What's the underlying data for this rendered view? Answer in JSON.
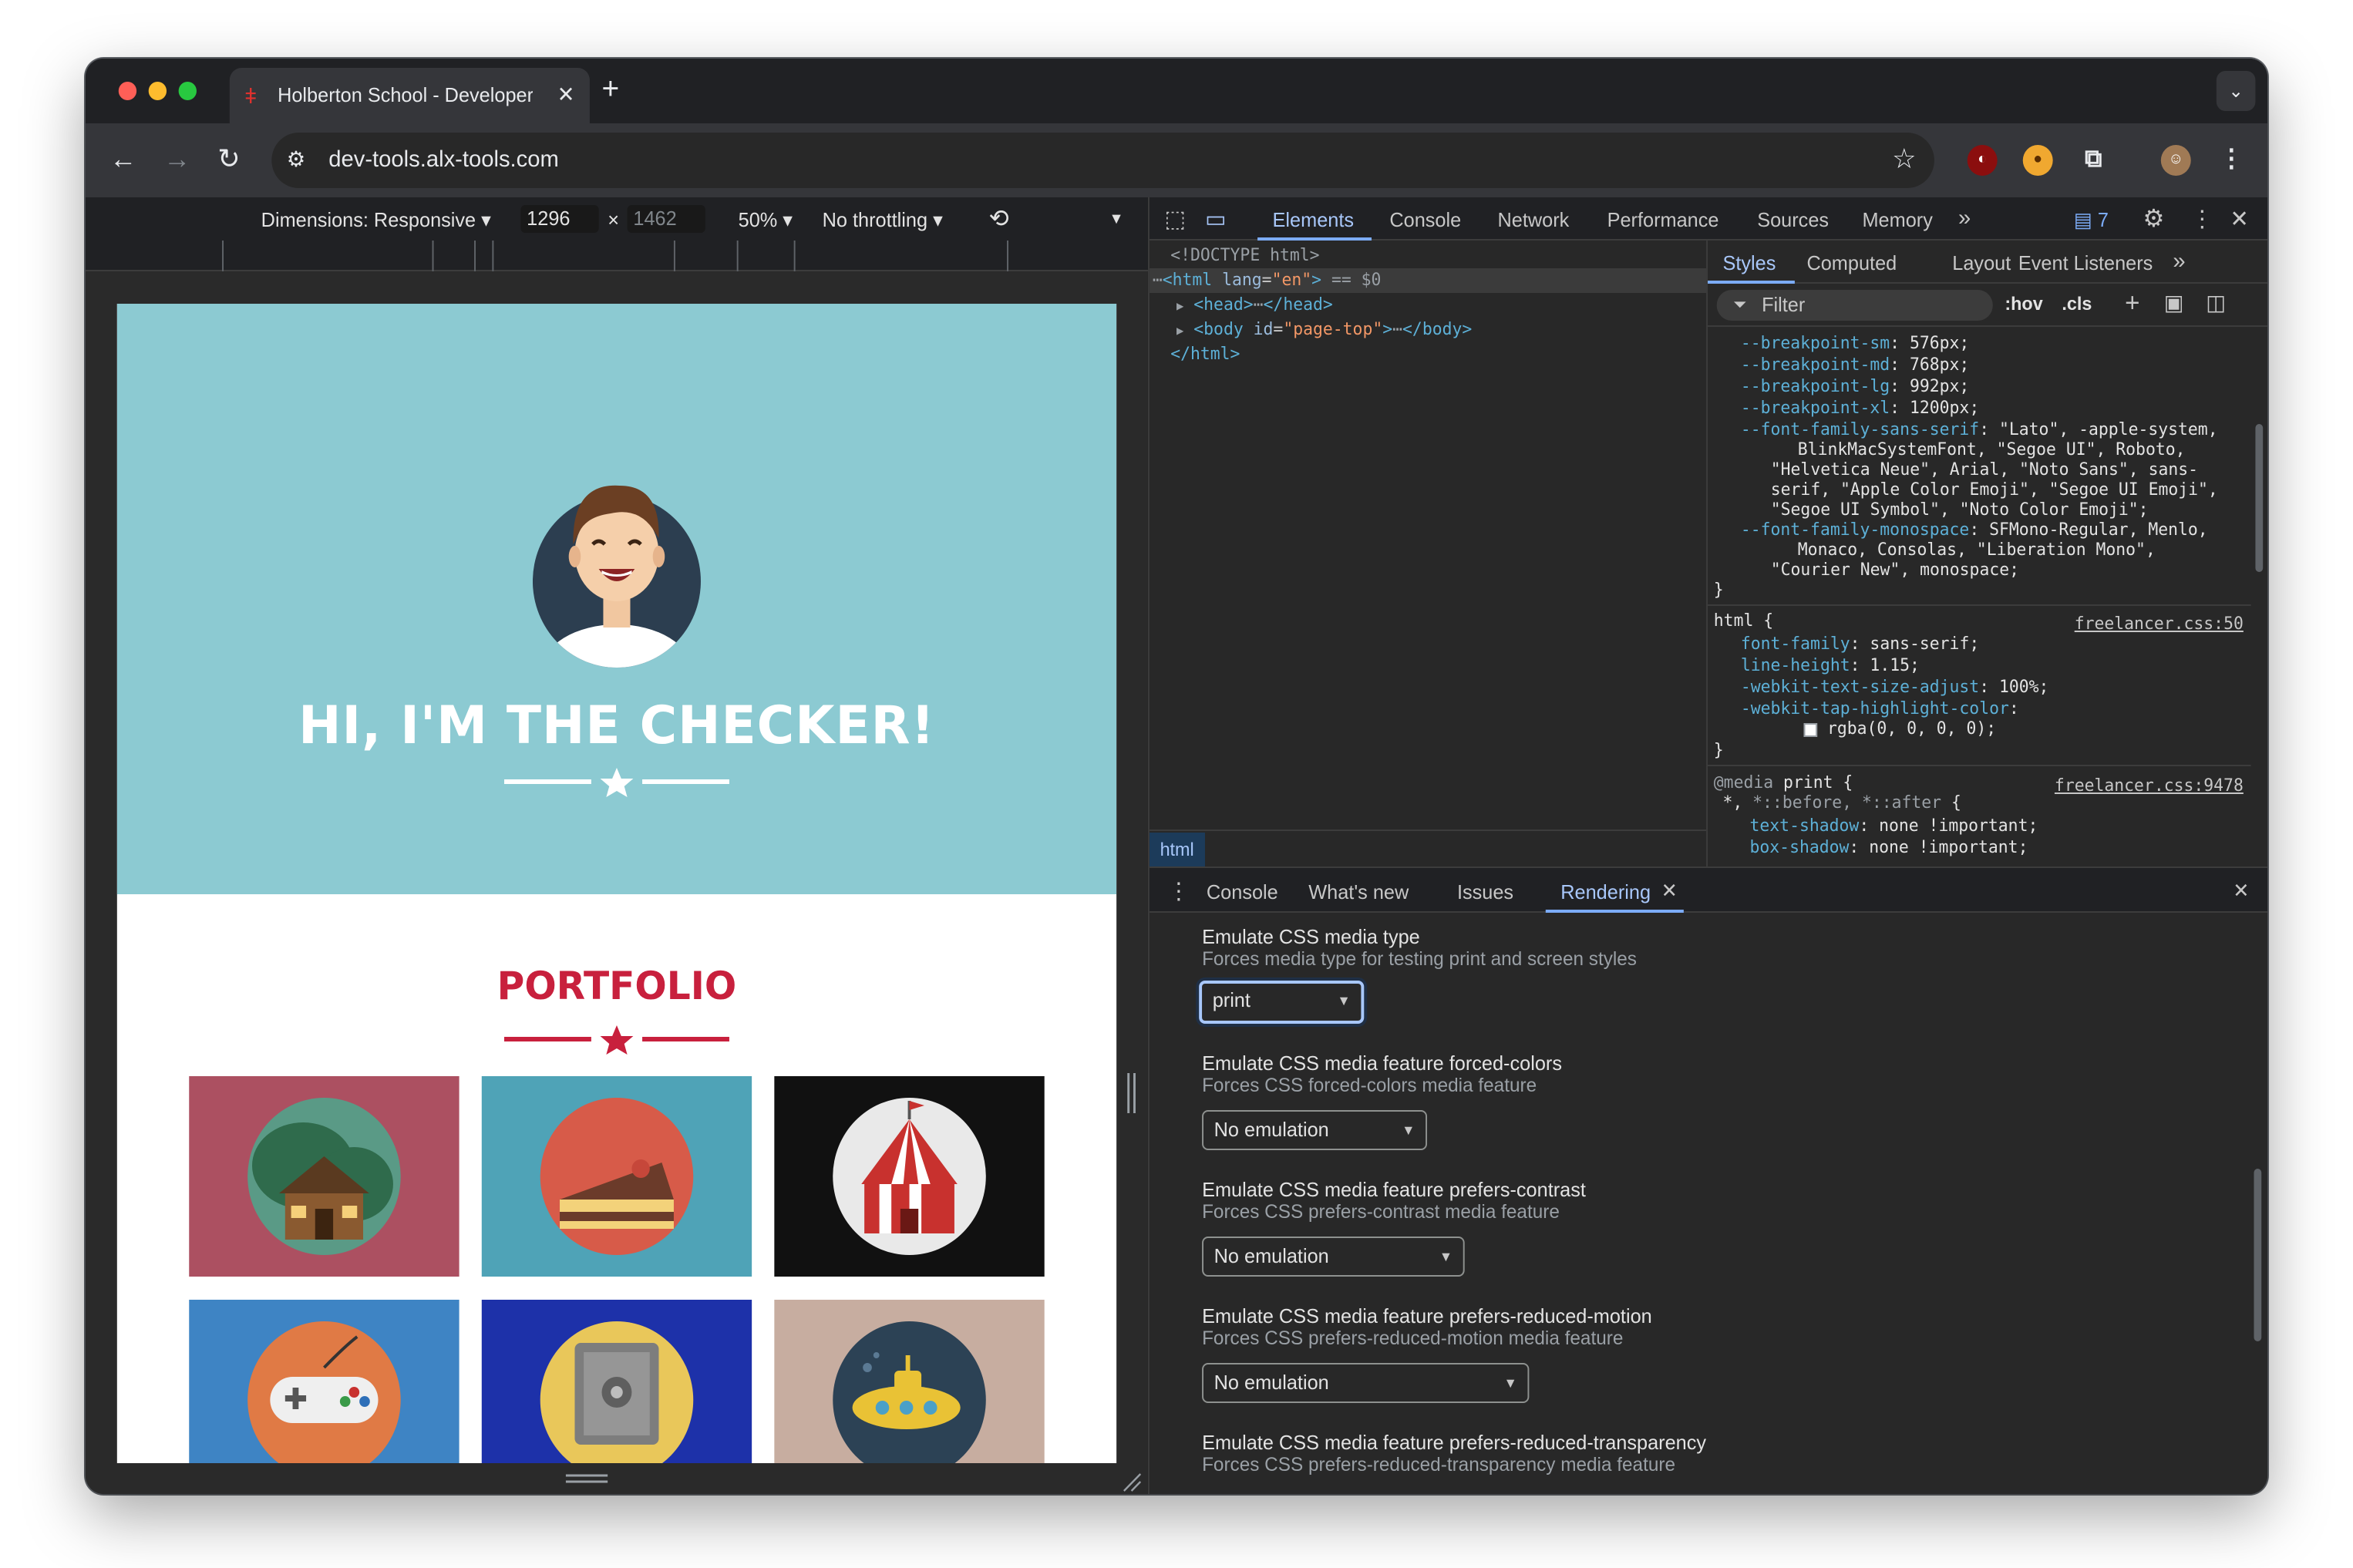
{
  "browser": {
    "tab_title": "Holberton School - Developer Tools",
    "tab_close": "✕",
    "new_tab": "+",
    "url": "dev-tools.alx-tools.com"
  },
  "device_toolbar": {
    "dimensions_label": "Dimensions: Responsive ▾",
    "width": "1296",
    "times": "×",
    "height": "1462",
    "zoom": "50% ▾",
    "throttling": "No throttling ▾"
  },
  "page": {
    "hero_title": "HI, I'M THE CHECKER!",
    "section_title": "PORTFOLIO",
    "colors": {
      "hero_bg": "#8ccad2",
      "accent": "#c8203d"
    },
    "thumbnails": [
      {
        "name": "cabin",
        "bg": "#ac5061"
      },
      {
        "name": "cake",
        "bg": "#4fa3b7"
      },
      {
        "name": "circus",
        "bg": "#111111"
      },
      {
        "name": "game-controller",
        "bg": "#3e84c4"
      },
      {
        "name": "safe",
        "bg": "#1d31a9"
      },
      {
        "name": "submarine",
        "bg": "#c7ada0"
      }
    ]
  },
  "devtools": {
    "tabs": [
      "Elements",
      "Console",
      "Network",
      "Performance",
      "Sources",
      "Memory"
    ],
    "more_tabs": "»",
    "issues_count": "7",
    "dom": {
      "doctype": "<!DOCTYPE html>",
      "html_open": "<html",
      "html_lang_attr": "lang",
      "html_lang_val": "\"en\"",
      "html_close_bracket": ">",
      "selected_marker": "== $0",
      "head": "<head>",
      "head_close": "</head>",
      "body_open": "<body",
      "body_id_attr": "id",
      "body_id_val": "\"page-top\"",
      "body_close": "</body>",
      "html_end": "</html>",
      "ellipsis": "⋯",
      "breadcrumb": "html"
    },
    "styles_tabs": [
      "Styles",
      "Computed",
      "Layout",
      "Event Listeners"
    ],
    "filter_placeholder": "Filter",
    "hov": ":hov",
    "cls": ".cls",
    "css_lines": [
      {
        "p": "--breakpoint-sm",
        "v": "576px;"
      },
      {
        "p": "--breakpoint-md",
        "v": "768px;"
      },
      {
        "p": "--breakpoint-lg",
        "v": "992px;"
      },
      {
        "p": "--breakpoint-xl",
        "v": "1200px;"
      },
      {
        "p": "--font-family-sans-serif",
        "v": "\"Lato\", -apple-system,"
      }
    ],
    "css_wrap_lines": [
      "BlinkMacSystemFont, \"Segoe UI\", Roboto,",
      "\"Helvetica Neue\", Arial, \"Noto Sans\", sans-",
      "serif, \"Apple Color Emoji\", \"Segoe UI Emoji\",",
      "\"Segoe UI Symbol\", \"Noto Color Emoji\";"
    ],
    "css_mono_prop": "--font-family-monospace",
    "css_mono_val": "SFMono-Regular, Menlo,",
    "css_mono_wrap": [
      "Monaco, Consolas, \"Liberation Mono\",",
      "\"Courier New\", monospace;"
    ],
    "rule_close": "}",
    "html_rule": {
      "selector": "html {",
      "source": "freelancer.css:50",
      "decls": [
        {
          "p": "font-family",
          "v": "sans-serif;"
        },
        {
          "p": "line-height",
          "v": "1.15;"
        },
        {
          "p": "-webkit-text-size-adjust",
          "v": "100%;"
        },
        {
          "p": "-webkit-tap-highlight-color",
          "v": ""
        }
      ],
      "rgba": "rgba(0, 0, 0, 0);"
    },
    "media_rule": {
      "at": "@media",
      "media": "print {",
      "source": "freelancer.css:9478",
      "selector_a": "*,",
      "selector_b": "*::before, *::after",
      "selector_brace": "{",
      "decls": [
        {
          "p": "text-shadow",
          "v": "none !important;"
        },
        {
          "p": "box-shadow",
          "v": "none !important;"
        }
      ]
    },
    "drawer_tabs": [
      "Console",
      "What's new",
      "Issues",
      "Rendering"
    ],
    "rendering": [
      {
        "title": "Emulate CSS media type",
        "desc": "Forces media type for testing print and screen styles",
        "value": "print"
      },
      {
        "title": "Emulate CSS media feature forced-colors",
        "desc": "Forces CSS forced-colors media feature",
        "value": "No emulation"
      },
      {
        "title": "Emulate CSS media feature prefers-contrast",
        "desc": "Forces CSS prefers-contrast media feature",
        "value": "No emulation"
      },
      {
        "title": "Emulate CSS media feature prefers-reduced-motion",
        "desc": "Forces CSS prefers-reduced-motion media feature",
        "value": "No emulation"
      },
      {
        "title": "Emulate CSS media feature prefers-reduced-transparency",
        "desc": "Forces CSS prefers-reduced-transparency media feature",
        "value": ""
      }
    ]
  }
}
